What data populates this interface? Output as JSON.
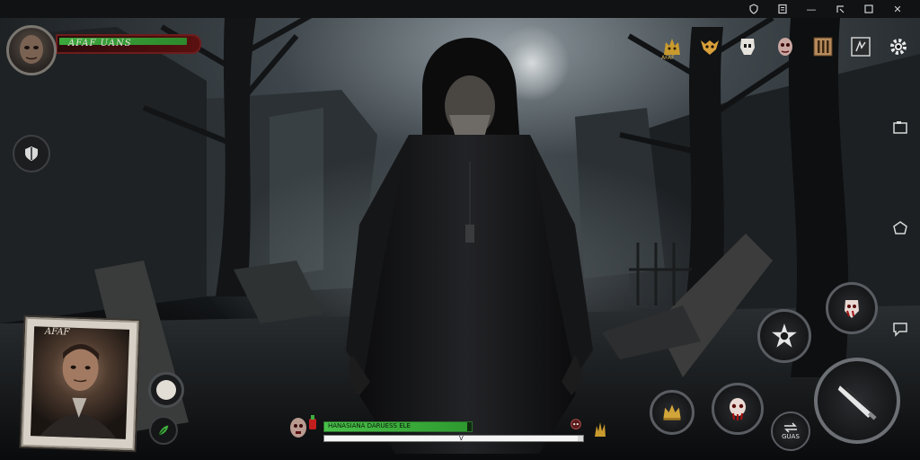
{
  "window": {
    "buttons": [
      {
        "name": "shield-app-icon"
      },
      {
        "name": "window-menu-icon"
      },
      {
        "name": "window-minimize-icon",
        "glyph": "—"
      },
      {
        "name": "window-restore-icon"
      },
      {
        "name": "window-maximize-icon"
      },
      {
        "name": "window-close-icon",
        "glyph": "✕"
      }
    ]
  },
  "player": {
    "name": "AFAF UANS",
    "health": 0.92,
    "health_color": "#3ca83c"
  },
  "top_icons": [
    {
      "name": "werewolf-icon",
      "label": "AFAF"
    },
    {
      "name": "wolf-skull-icon",
      "label": ""
    },
    {
      "name": "ghost-mask-icon",
      "label": ""
    },
    {
      "name": "demon-face-icon",
      "label": ""
    },
    {
      "name": "inventory-bars-icon",
      "label": ""
    },
    {
      "name": "map-icon",
      "label": ""
    },
    {
      "name": "settings-gear-icon",
      "label": ""
    }
  ],
  "side_icons": [
    {
      "name": "screen-capture-icon"
    },
    {
      "name": "shape-toggle-icon"
    },
    {
      "name": "chat-bubble-icon"
    }
  ],
  "companion": {
    "label": "AFAF"
  },
  "bottom_hud": {
    "xp_fill": 0.97,
    "xp_text": "HANASIANA DARUESS ELE",
    "stamina_fill": 0.98,
    "stamina_mark": "V"
  },
  "skills": {
    "swap_label": "GUAS"
  },
  "colors": {
    "accent_red": "#8b1a1a",
    "hp_green": "#3ca83c",
    "ui_metal": "#595d62"
  }
}
